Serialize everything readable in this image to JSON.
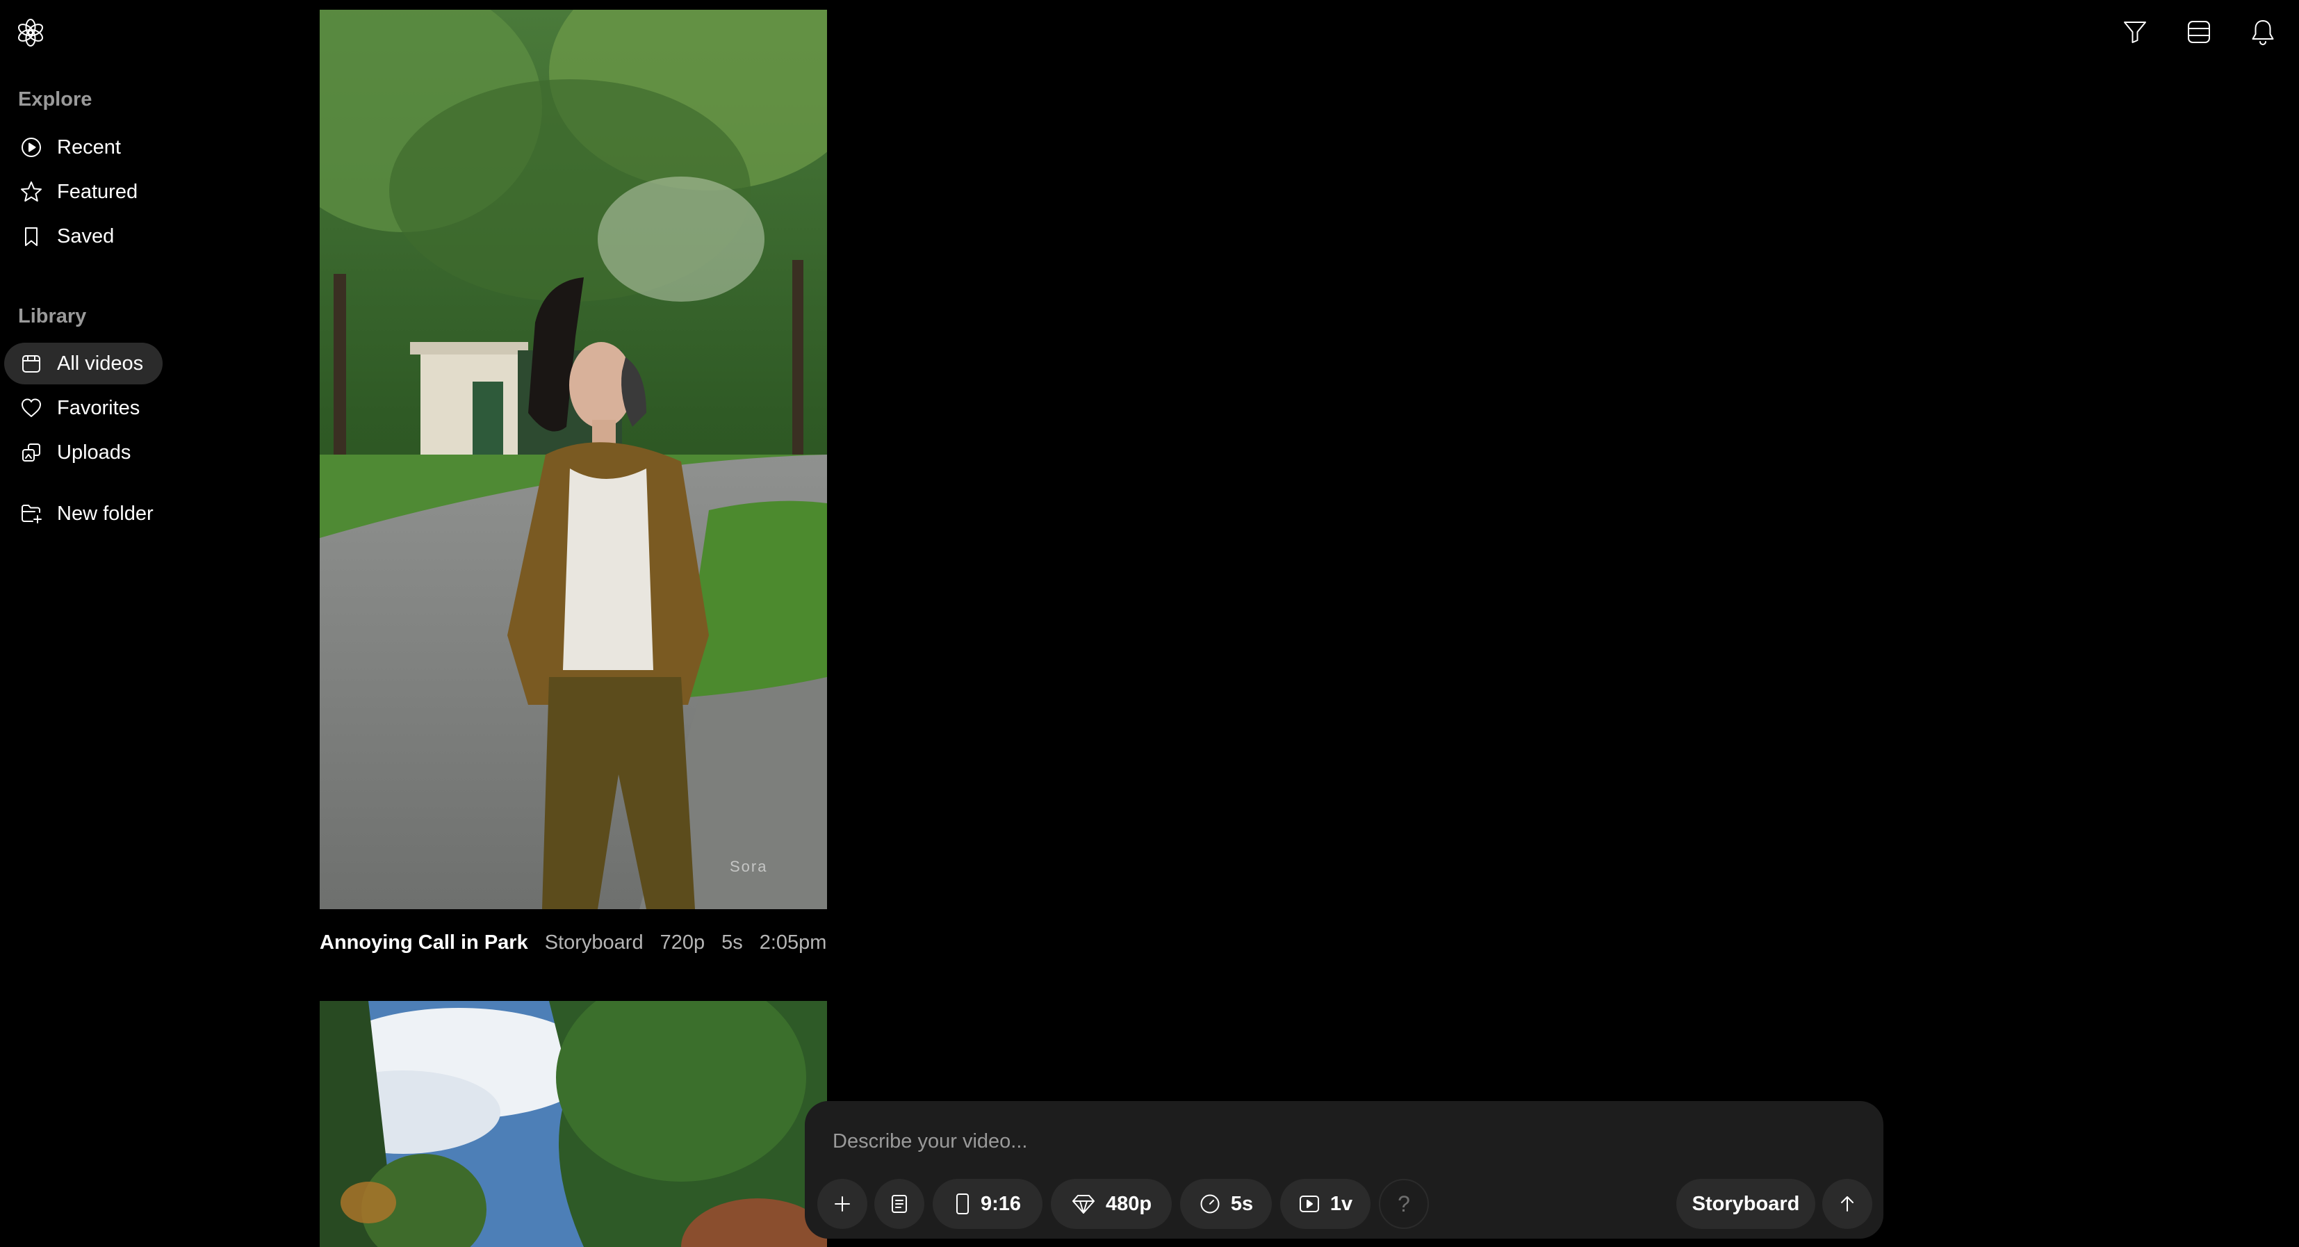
{
  "sidebar": {
    "explore_title": "Explore",
    "explore_items": [
      {
        "label": "Recent",
        "icon": "play-circle-icon"
      },
      {
        "label": "Featured",
        "icon": "star-icon"
      },
      {
        "label": "Saved",
        "icon": "bookmark-icon"
      }
    ],
    "library_title": "Library",
    "library_items": [
      {
        "label": "All videos",
        "icon": "calendar-icon",
        "active": true
      },
      {
        "label": "Favorites",
        "icon": "heart-icon"
      },
      {
        "label": "Uploads",
        "icon": "uploads-icon"
      }
    ],
    "new_folder": {
      "label": "New folder",
      "icon": "folder-plus-icon"
    }
  },
  "topbar": {
    "icons": [
      "filter-icon",
      "layout-list-icon",
      "bell-icon"
    ]
  },
  "feed": {
    "items": [
      {
        "title": "Annoying Call in Park",
        "type": "Storyboard",
        "resolution": "720p",
        "duration": "5s",
        "time": "2:05pm",
        "watermark": "Sora"
      }
    ]
  },
  "composer": {
    "placeholder": "Describe your video...",
    "aspect_ratio": "9:16",
    "resolution": "480p",
    "duration": "5s",
    "variations": "1v",
    "help": "?",
    "storyboard_label": "Storyboard"
  },
  "colors": {
    "background": "#000000",
    "composer_bg": "#1d1d1d",
    "pill_bg": "#2b2b2b",
    "muted_text": "#9a9a9a"
  }
}
